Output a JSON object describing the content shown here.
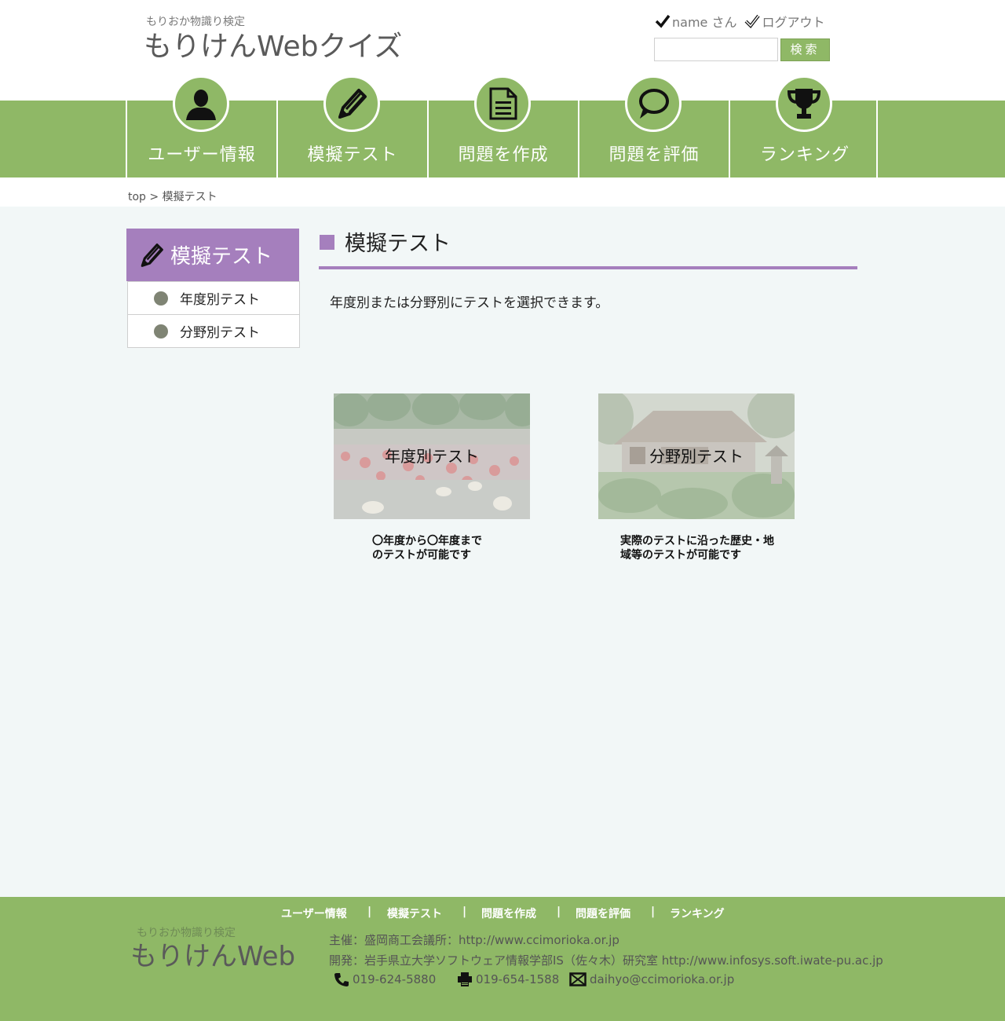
{
  "header": {
    "logo_sub": "もりおか物識り検定",
    "logo_main": "もりけんWebクイズ",
    "user_name": "name さん",
    "logout": "ログアウト",
    "search_placeholder": "",
    "search_button": "検索"
  },
  "nav": {
    "items": [
      {
        "label": "ユーザー情報",
        "icon": "user-icon"
      },
      {
        "label": "模擬テスト",
        "icon": "pen-icon"
      },
      {
        "label": "問題を作成",
        "icon": "document-icon"
      },
      {
        "label": "問題を評価",
        "icon": "speech-bubble-icon"
      },
      {
        "label": "ランキング",
        "icon": "trophy-icon"
      }
    ]
  },
  "breadcrumb": "top > 模擬テスト",
  "sidebar": {
    "title": "模擬テスト",
    "items": [
      {
        "label": "年度別テスト"
      },
      {
        "label": "分野別テスト"
      }
    ]
  },
  "main": {
    "title": "模擬テスト",
    "description": "年度別または分野別にテストを選択できます。",
    "cards": [
      {
        "label": "年度別テスト",
        "desc_line1": "〇年度から〇年度まで",
        "desc_line2": "のテストが可能です"
      },
      {
        "label": "分野別テスト",
        "desc_line1": "実際のテストに沿った歴史・地",
        "desc_line2": "域等のテストが可能です"
      }
    ]
  },
  "footer": {
    "nav": [
      "ユーザー情報",
      "模擬テスト",
      "問題を作成",
      "問題を評価",
      "ランキング"
    ],
    "separator": "|",
    "logo_sub": "もりおか物識り検定",
    "logo_main": "もりけんWeb",
    "host": "主催：盛岡商工会議所：http://www.ccimorioka.or.jp",
    "developer": "開発：岩手県立大学ソフトウェア情報学部IS（佐々木）研究室 http://www.infosys.soft.iwate-pu.ac.jp",
    "phone": "019-624-5880",
    "fax": "019-654-1588",
    "email": "daihyo@ccimorioka.or.jp"
  },
  "colors": {
    "green": "#8fb866",
    "purple": "#a57fbd",
    "background": "#f2f7f7"
  }
}
